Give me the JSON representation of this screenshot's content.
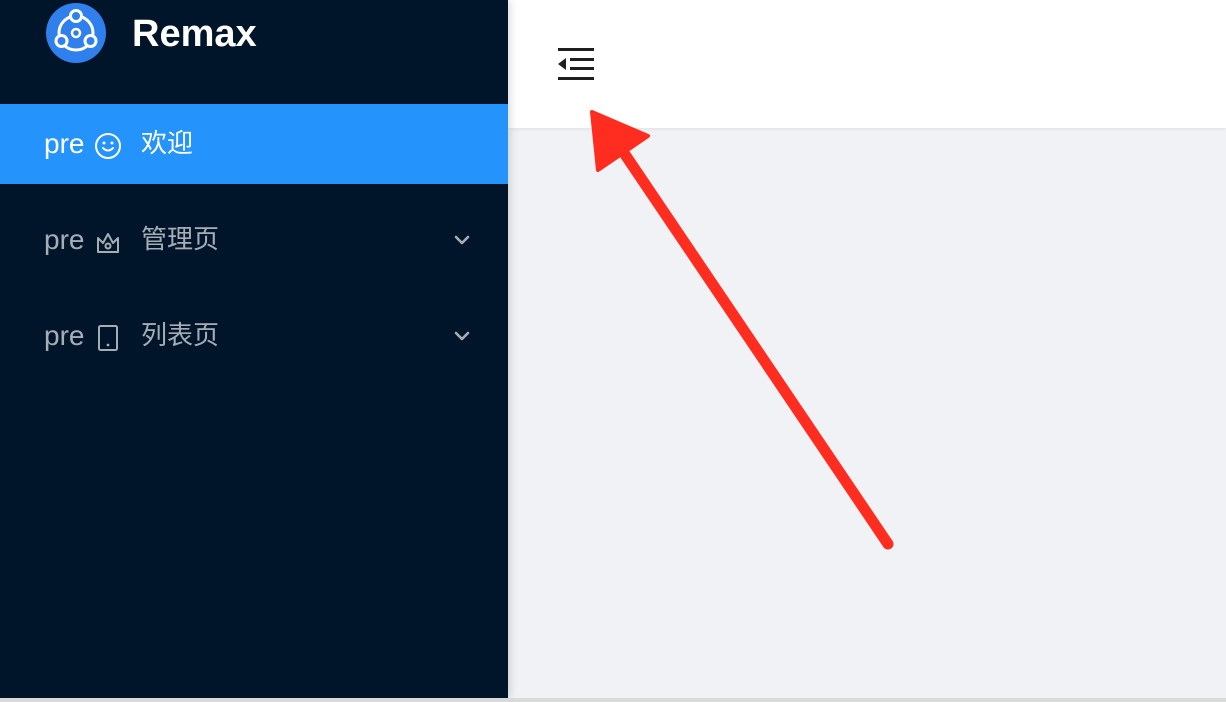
{
  "app": {
    "title": "Remax"
  },
  "sidebar": {
    "items": [
      {
        "prefix": "pre",
        "icon": "smile-icon",
        "label": "欢迎",
        "selected": true,
        "has_submenu": false
      },
      {
        "prefix": "pre",
        "icon": "crown-icon",
        "label": "管理页",
        "selected": false,
        "has_submenu": true
      },
      {
        "prefix": "pre",
        "icon": "tablet-icon",
        "label": "列表页",
        "selected": false,
        "has_submenu": true
      }
    ]
  },
  "header": {
    "trigger_icon": "menu-fold-icon"
  },
  "annotation": {
    "type": "arrow",
    "color": "#ff2d20",
    "points_to": "menu-fold-icon"
  },
  "colors": {
    "sidebar_bg": "#001529",
    "selected_bg": "#2593fc",
    "content_bg": "#f0f2f5",
    "logo_blue": "#2f80ed"
  }
}
